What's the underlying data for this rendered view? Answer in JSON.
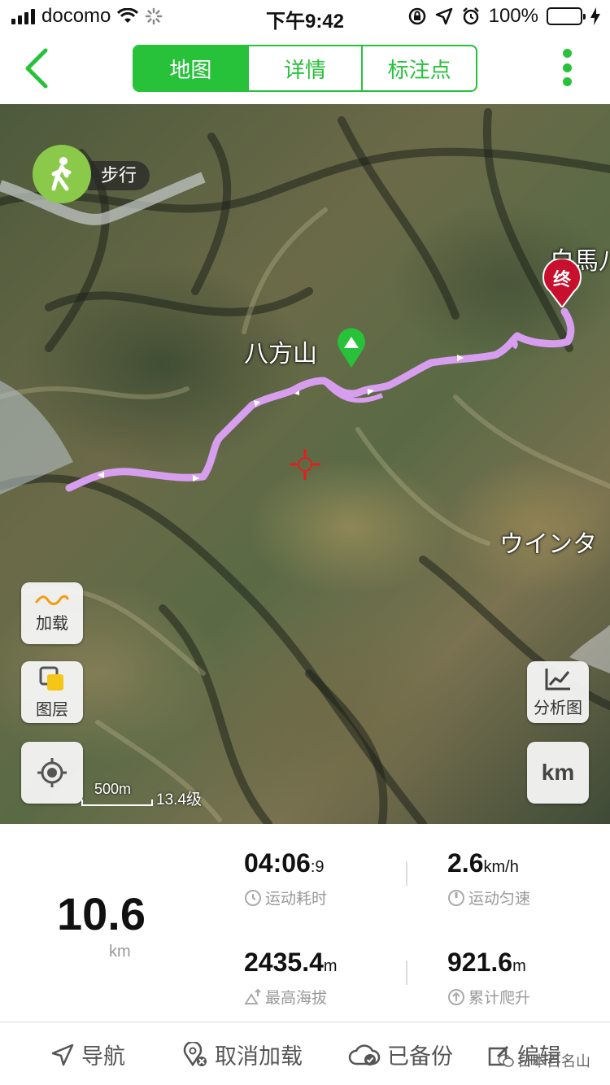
{
  "status_bar": {
    "carrier": "docomo",
    "time": "下午9:42",
    "battery": "100%"
  },
  "nav": {
    "tabs": [
      {
        "label": "地图"
      },
      {
        "label": "详情"
      },
      {
        "label": "标注点"
      }
    ]
  },
  "map": {
    "mode_label": "步行",
    "peak_label": "八方山",
    "place_label_1": "白馬八",
    "place_label_2": "ウインタ",
    "end_marker": "终",
    "load_label": "加载",
    "layer_label": "图层",
    "analysis_label": "分析图",
    "unit_toggle": "km",
    "scale_label": "500m",
    "zoom_label": "13.4级",
    "route_color": "#d79ef0"
  },
  "stats": {
    "distance": "10.6",
    "distance_unit": "km",
    "duration_main": "04:06",
    "duration_sub": ":9",
    "duration_caption": "运动耗时",
    "speed_value": "2.6",
    "speed_unit": "km/h",
    "speed_caption": "运动匀速",
    "altitude_value": "2435.4",
    "altitude_unit": "m",
    "altitude_caption": "最高海拔",
    "climb_value": "921.6",
    "climb_unit": "m",
    "climb_caption": "累计爬升"
  },
  "bottom": {
    "navigate": "导航",
    "cancel_load": "取消加载",
    "backed_up": "已备份",
    "edit": "编辑",
    "watermark": "日本百名山"
  }
}
